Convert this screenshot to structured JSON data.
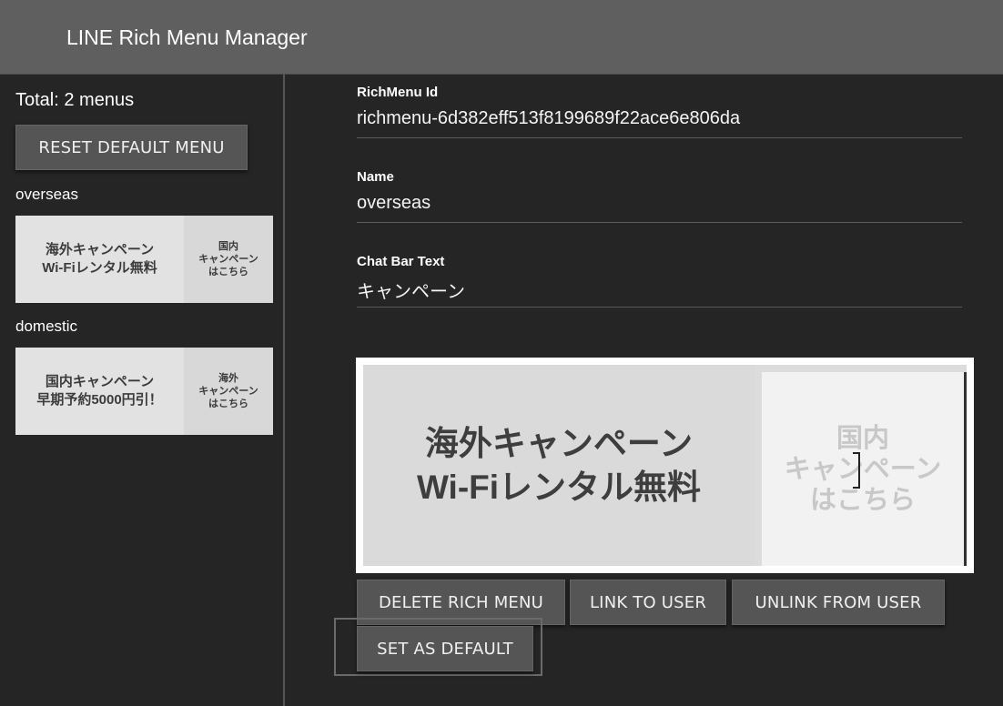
{
  "app": {
    "title": "LINE Rich Menu Manager"
  },
  "sidebar": {
    "total_text": "Total: 2 menus",
    "reset_button": "RESET DEFAULT MENU",
    "menus": [
      {
        "name": "overseas",
        "thumb_main": "海外キャンペーン\nWi-Fiレンタル無料",
        "thumb_side": "国内\nキャンペーン\nはこちら"
      },
      {
        "name": "domestic",
        "thumb_main": "国内キャンペーン\n早期予約5000円引！",
        "thumb_side": "海外\nキャンペーン\nはこちら"
      }
    ]
  },
  "detail": {
    "id_label": "RichMenu Id",
    "id_value": "richmenu-6d382eff513f8199689f22ace6e806da",
    "name_label": "Name",
    "name_value": "overseas",
    "chatbar_label": "Chat Bar Text",
    "chatbar_value": "キャンペーン",
    "preview_main": "海外キャンペーン\nWi-Fiレンタル無料",
    "preview_side": "国内\nキャンペーン\nはこちら"
  },
  "actions": {
    "delete": "DELETE RICH MENU",
    "link": "LINK TO USER",
    "unlink": "UNLINK FROM USER",
    "set_default": "SET AS DEFAULT"
  },
  "colors": {
    "topbar": "#5f5f5f",
    "background": "#252525",
    "button": "#555555"
  }
}
